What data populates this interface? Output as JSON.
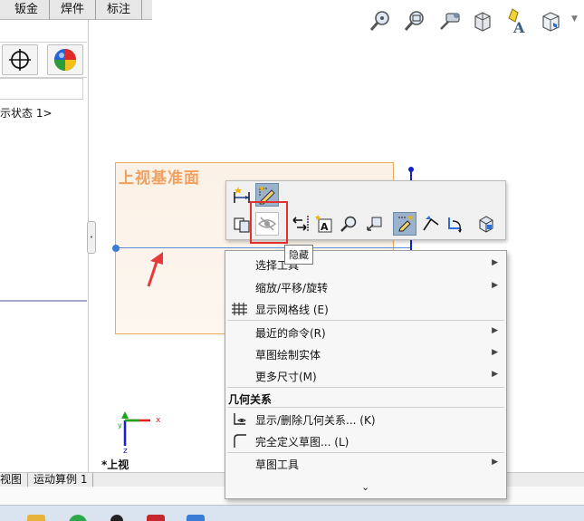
{
  "tabs": [
    "钣金",
    "焊件",
    "标注"
  ],
  "panel": {
    "display_state_text": "示状态 1>",
    "handle_glyph": "•"
  },
  "bottom_tabs": [
    "视图",
    "运动算例 1"
  ],
  "view": {
    "plane_label": "上视基准面",
    "view_name": "*上视",
    "axis_x_label": "x",
    "axis_y_label": "y",
    "axis_z_label": "z"
  },
  "heads_up_icons": [
    "zoom-to-fit-icon",
    "zoom-to-area-icon",
    "previous-view-icon",
    "section-view-icon",
    "display-style-icon",
    "view-orientation-icon"
  ],
  "context_toolbar": {
    "row1": [
      "smart-dimension-icon",
      "sketch-icon"
    ],
    "row2": [
      "copy-icon",
      "hide-icon",
      "move-entities-icon",
      "annotation-icon",
      "zoom-icon",
      "rotate-view-icon",
      "sketch-selection-icon",
      "convert-entities-icon",
      "offset-icon",
      "3d-view-icon"
    ],
    "tooltip": "隐藏"
  },
  "menu": {
    "items": [
      {
        "label": "选择工具",
        "submenu": true,
        "icon": ""
      },
      {
        "label": "缩放/平移/旋转",
        "submenu": true,
        "icon": ""
      },
      {
        "label": "显示网格线 (E)",
        "submenu": false,
        "icon": "grid-icon"
      },
      {
        "label": "最近的命令(R)",
        "submenu": true,
        "icon": ""
      },
      {
        "label": "草图绘制实体",
        "submenu": true,
        "icon": ""
      },
      {
        "label": "更多尺寸(M)",
        "submenu": true,
        "icon": ""
      },
      {
        "label": "显示/删除几何关系... (K)",
        "submenu": false,
        "icon": "relations-icon"
      },
      {
        "label": "完全定义草图... (L)",
        "submenu": false,
        "icon": "fully-define-icon"
      },
      {
        "label": "草图工具",
        "submenu": true,
        "icon": ""
      }
    ],
    "section_header": "几何关系",
    "submenu_arrow": "▶",
    "more_glyph": "⌄"
  },
  "colors": {
    "plane_border": "#f0a85a",
    "plane_text": "#f0a060",
    "sketch_line": "#5b8fd9",
    "highlight_red": "#e53030"
  }
}
